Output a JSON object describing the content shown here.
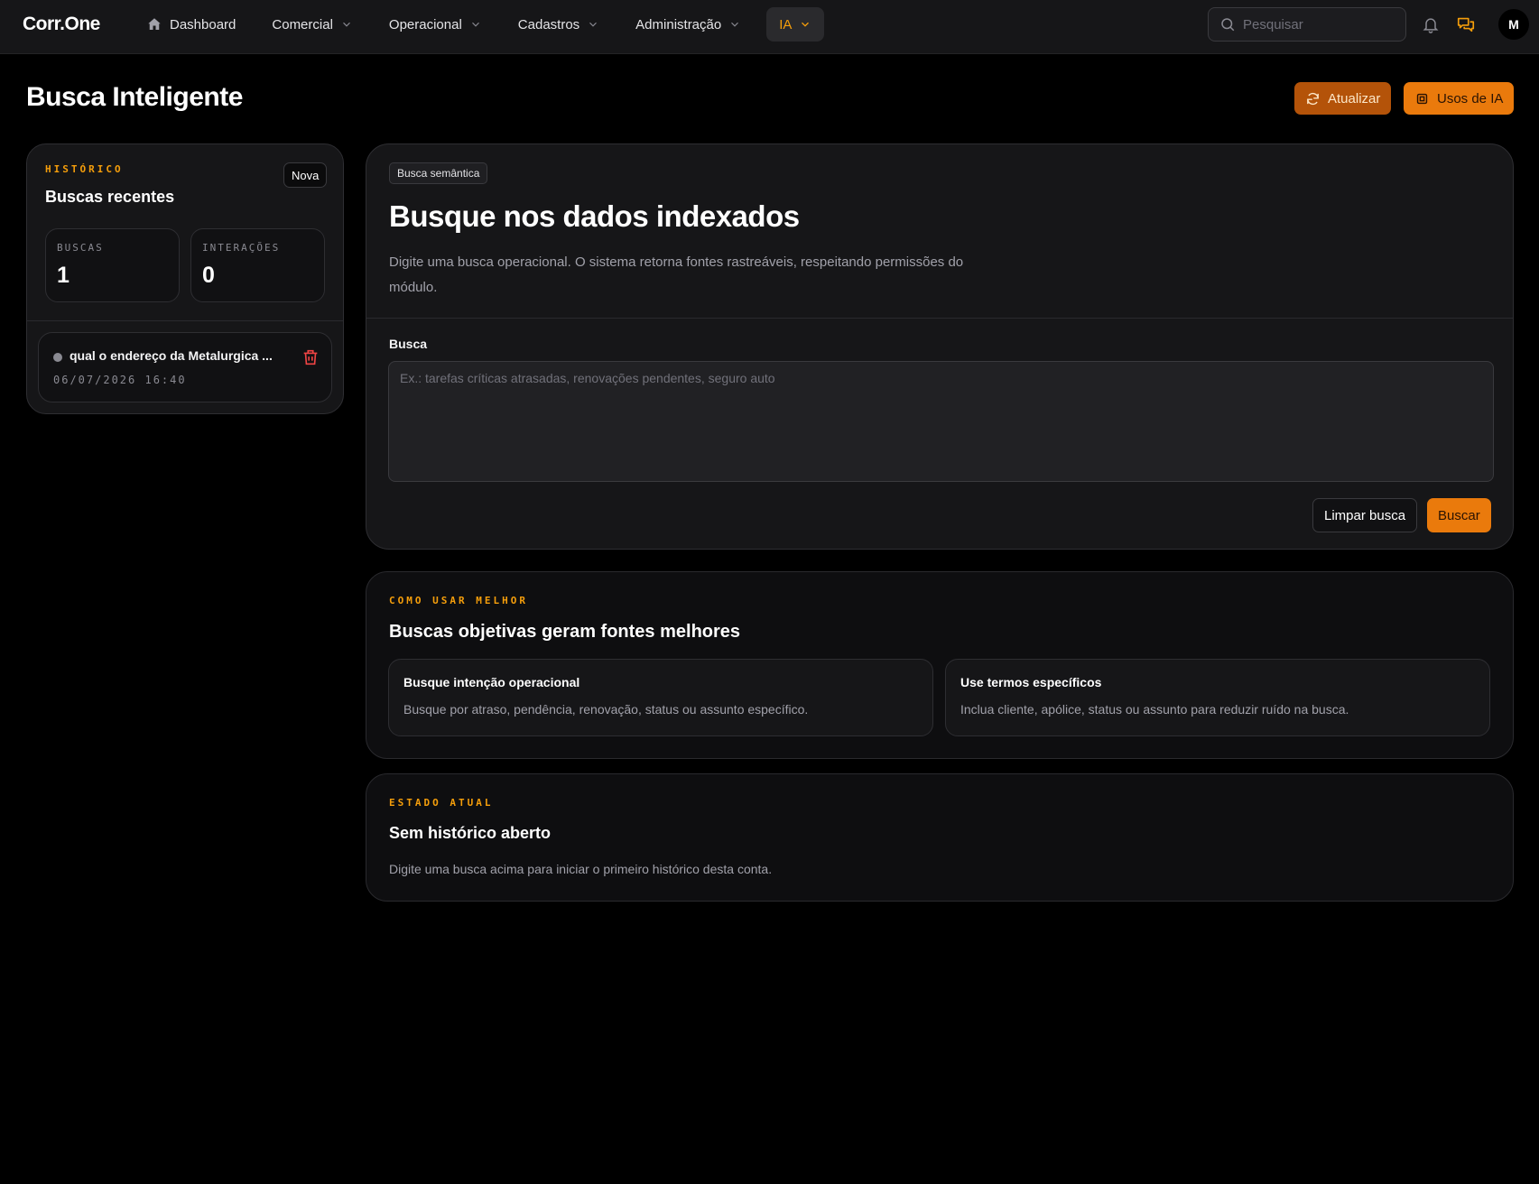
{
  "brand": "Corr.One",
  "nav": {
    "items": [
      {
        "label": "Dashboard"
      },
      {
        "label": "Comercial"
      },
      {
        "label": "Operacional"
      },
      {
        "label": "Cadastros"
      },
      {
        "label": "Administração"
      },
      {
        "label": "IA",
        "active": true
      }
    ],
    "search_placeholder": "Pesquisar",
    "avatar_initial": "M",
    "icons": [
      "home-icon",
      "search-icon",
      "bell-icon",
      "chat-icon"
    ]
  },
  "page": {
    "title": "Busca Inteligente",
    "refresh_label": "Atualizar",
    "usage_label": "Usos de IA"
  },
  "history": {
    "eyebrow": "HISTÓRICO",
    "title": "Buscas recentes",
    "new_label": "Nova",
    "stats": [
      {
        "label": "BUSCAS",
        "value": "1"
      },
      {
        "label": "INTERAÇÕES",
        "value": "0"
      }
    ],
    "items": [
      {
        "text": "qual o endereço da Metalurgica ...",
        "date": "06/07/2026 16:40"
      }
    ]
  },
  "search": {
    "chip": "Busca semântica",
    "title": "Busque nos dados indexados",
    "description": "Digite uma busca operacional. O sistema retorna fontes rastreáveis, respeitando permissões do módulo.",
    "field_label": "Busca",
    "placeholder": "Ex.: tarefas críticas atrasadas, renovações pendentes, seguro auto",
    "value": "",
    "clear_label": "Limpar busca",
    "submit_label": "Buscar"
  },
  "tips": {
    "eyebrow": "COMO USAR MELHOR",
    "title": "Buscas objetivas geram fontes melhores",
    "items": [
      {
        "title": "Busque intenção operacional",
        "body": "Busque por atraso, pendência, renovação, status ou assunto específico."
      },
      {
        "title": "Use termos específicos",
        "body": "Inclua cliente, apólice, status ou assunto para reduzir ruído na busca."
      }
    ]
  },
  "state": {
    "eyebrow": "ESTADO ATUAL",
    "title": "Sem histórico aberto",
    "body": "Digite uma busca acima para iniciar o primeiro histórico desta conta."
  },
  "colors": {
    "accent": "#f59e0b",
    "primary_button": "#ea7a0c",
    "secondary_button": "#b45309",
    "danger": "#ef4444"
  }
}
